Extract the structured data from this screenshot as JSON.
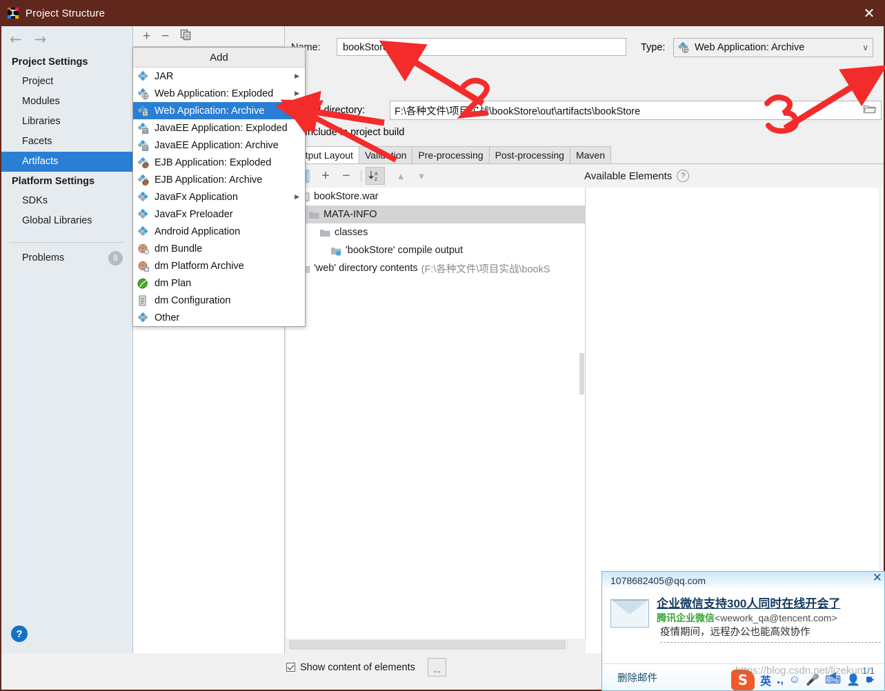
{
  "window": {
    "title": "Project Structure",
    "icon": "intellij-idea-icon",
    "close_label": "✕",
    "titlebar_color": "#60281c"
  },
  "sidebar": {
    "back_arrow": "←",
    "forward_arrow": "→",
    "groups": [
      {
        "heading": "Project Settings",
        "items": [
          {
            "label": "Project",
            "selected": false
          },
          {
            "label": "Modules",
            "selected": false
          },
          {
            "label": "Libraries",
            "selected": false
          },
          {
            "label": "Facets",
            "selected": false
          },
          {
            "label": "Artifacts",
            "selected": true
          }
        ]
      },
      {
        "heading": "Platform Settings",
        "items": [
          {
            "label": "SDKs",
            "selected": false
          },
          {
            "label": "Global Libraries",
            "selected": false
          }
        ]
      }
    ],
    "problems": {
      "label": "Problems",
      "count": "8"
    },
    "help_label": "?",
    "selection_color": "#2a7fd4"
  },
  "artifacts_toolbar": {
    "add": "+",
    "remove": "−",
    "copy": "copy-icon"
  },
  "add_menu": {
    "title": "Add",
    "items": [
      {
        "label": "JAR",
        "icon": "jar-icon",
        "submenu": true,
        "selected": false
      },
      {
        "label": "Web Application: Exploded",
        "icon": "web-exploded-icon",
        "submenu": true,
        "selected": false
      },
      {
        "label": "Web Application: Archive",
        "icon": "web-archive-icon",
        "submenu": false,
        "selected": true
      },
      {
        "label": "JavaEE Application: Exploded",
        "icon": "javaee-exploded-icon",
        "submenu": false,
        "selected": false
      },
      {
        "label": "JavaEE Application: Archive",
        "icon": "javaee-archive-icon",
        "submenu": false,
        "selected": false
      },
      {
        "label": "EJB Application: Exploded",
        "icon": "ejb-exploded-icon",
        "submenu": false,
        "selected": false
      },
      {
        "label": "EJB Application: Archive",
        "icon": "ejb-archive-icon",
        "submenu": false,
        "selected": false
      },
      {
        "label": "JavaFx Application",
        "icon": "javafx-icon",
        "submenu": true,
        "selected": false
      },
      {
        "label": "JavaFx Preloader",
        "icon": "javafx-preloader-icon",
        "submenu": false,
        "selected": false
      },
      {
        "label": "Android Application",
        "icon": "android-icon",
        "submenu": false,
        "selected": false
      },
      {
        "label": "dm Bundle",
        "icon": "dm-bundle-icon",
        "submenu": false,
        "selected": false
      },
      {
        "label": "dm Platform Archive",
        "icon": "dm-platform-icon",
        "submenu": false,
        "selected": false
      },
      {
        "label": "dm Plan",
        "icon": "dm-plan-icon",
        "submenu": false,
        "selected": false
      },
      {
        "label": "dm Configuration",
        "icon": "dm-config-icon",
        "submenu": false,
        "selected": false
      },
      {
        "label": "Other",
        "icon": "other-icon",
        "submenu": false,
        "selected": false
      }
    ]
  },
  "editor": {
    "name_label": "Name:",
    "name_value": "bookStore",
    "type_label": "Type:",
    "type_value": "Web Application: Archive",
    "type_chevron": "∨",
    "output_dir_label": "Output directory:",
    "output_dir_value": "F:\\各种文件\\项目实战\\bookStore\\out\\artifacts\\bookStore",
    "browse_icon": "folder-open-icon",
    "include_in_build_label": "Include in project build",
    "include_in_build_checked": false,
    "tabs": [
      {
        "label": "Output Layout",
        "active": true
      },
      {
        "label": "Validation",
        "active": false
      },
      {
        "label": "Pre-processing",
        "active": false
      },
      {
        "label": "Post-processing",
        "active": false
      },
      {
        "label": "Maven",
        "active": false
      }
    ],
    "layout_toolbar": {
      "facet_icon": "facet-resources-icon",
      "add": "+",
      "remove": "−",
      "sort": "sort-az-icon",
      "move_up": "▲",
      "move_down": "▼"
    },
    "available_elements_label": "Available Elements",
    "available_elements_help": "?",
    "tree": [
      {
        "label": "bookStore.war",
        "indent": 0,
        "icon": "archive-icon",
        "twisty": "",
        "selected": false,
        "suffix": ""
      },
      {
        "label": "MATA-INFO",
        "indent": 1,
        "icon": "folder-icon",
        "twisty": "▶",
        "selected": true,
        "suffix": ""
      },
      {
        "label": "classes",
        "indent": 1,
        "icon": "folder-icon",
        "twisty": "▼",
        "selected": false,
        "suffix": ""
      },
      {
        "label": "'bookStore' compile output",
        "indent": 2,
        "icon": "module-output-icon",
        "twisty": "",
        "selected": false,
        "suffix": ""
      },
      {
        "label": "'web' directory contents",
        "indent": 0,
        "icon": "folder-dir-icon",
        "twisty": "",
        "selected": false,
        "suffix": "(F:\\各种文件\\项目实战\\bookS"
      }
    ],
    "show_content_label": "Show content of elements",
    "show_content_checked": true,
    "show_content_more": "..."
  },
  "annotations": [
    {
      "label": "2",
      "color": "#f42b2b"
    },
    {
      "label": "3",
      "color": "#f42b2b"
    }
  ],
  "qq_popup": {
    "account": "1078682405@qq.com",
    "close": "✕",
    "mail_icon": "envelope-icon",
    "subject": "企业微信支持300人同时在线开会了",
    "sender_name": "腾讯企业微信",
    "sender_address": "<wework_qa@tencent.com>",
    "snippet": "疫情期间，远程办公也能高效协作",
    "ellipsis": "...",
    "delete_label": "删除邮件",
    "pager": "1/1",
    "prev": "◀",
    "next": "▶"
  },
  "ime_bar": {
    "logo": "sogou-logo-icon",
    "mode": "英",
    "punctuation": "punctuation-icon",
    "emoji": "smiley-icon",
    "voice": "microphone-icon",
    "keyboard": "keyboard-icon",
    "user": "user-icon",
    "toolbox": "toolbox-icon"
  },
  "watermark": "https://blog.csdn.net/lizekun"
}
